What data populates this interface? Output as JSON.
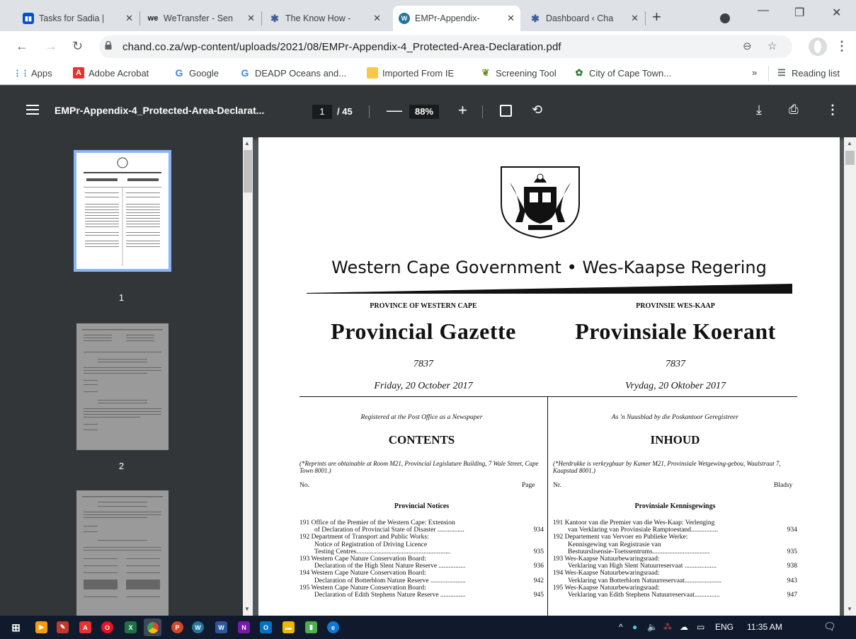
{
  "tabs": [
    {
      "title": "Tasks for Sadia |",
      "icon": "trello-icon",
      "color": "#0052cc"
    },
    {
      "title": "WeTransfer - Sen",
      "icon": "wetransfer-icon",
      "color": "#17181a"
    },
    {
      "title": "The Know How -",
      "icon": "gear-icon",
      "color": "#3d5a99"
    },
    {
      "title": "EMPr-Appendix-",
      "icon": "wordpress-icon",
      "color": "#21759b"
    },
    {
      "title": "Dashboard ‹ Cha",
      "icon": "gear-icon",
      "color": "#3d5a99"
    }
  ],
  "browser": {
    "url": "chand.co.za/wp-content/uploads/2021/08/EMPr-Appendix-4_Protected-Area-Declaration.pdf",
    "new_tab": "+"
  },
  "bookmarks": [
    {
      "label": "Apps",
      "icon": "apps-grid-icon",
      "color": "#1a73e8"
    },
    {
      "label": "Adobe Acrobat",
      "icon": "acrobat-icon",
      "color": "#e8312f"
    },
    {
      "label": "Google",
      "icon": "google-icon",
      "color": "#4285f4"
    },
    {
      "label": "DEADP Oceans and...",
      "icon": "google-icon",
      "color": "#4285f4"
    },
    {
      "label": "Imported From IE",
      "icon": "folder-icon",
      "color": "#f9c846"
    },
    {
      "label": "Screening Tool",
      "icon": "leaf-icon",
      "color": "#6b8e23"
    },
    {
      "label": "City of Cape Town...",
      "icon": "city-icon",
      "color": "#2e7d32"
    }
  ],
  "bookmarks_overflow": "»",
  "reading_list": "Reading list",
  "pdf": {
    "title": "EMPr-Appendix-4_Protected-Area-Declarat...",
    "page_current": "1",
    "page_total": "/ 45",
    "zoom": "88%",
    "zoom_minus": "—",
    "zoom_plus": "+"
  },
  "thumbnails": [
    {
      "number": "1",
      "selected": true
    },
    {
      "number": "2",
      "selected": false
    },
    {
      "number": "3",
      "selected": false
    }
  ],
  "document": {
    "government": "Western Cape Government  •  Wes-Kaapse Regering",
    "left": {
      "province": "PROVINCE OF WESTERN CAPE",
      "gazette": "Provincial Gazette",
      "number": "7837",
      "date": "Friday, 20 October 2017",
      "registered": "Registered at the Post Office as a Newspaper",
      "contents": "CONTENTS",
      "reprint": "(*Reprints are obtainable at Room M21, Provincial Legislature Building, 7 Wale Street, Cape Town 8001.)",
      "col_no": "No.",
      "col_page": "Page",
      "section": "Provincial Notices",
      "entries": [
        {
          "lines": [
            "191 Office of the Premier of the Western Cape: Extension",
            "of Declaration of Provincial State of Disaster ................"
          ],
          "page": "934"
        },
        {
          "lines": [
            "192 Department of Transport and Public Works:",
            "Notice of Registration of Driving Licence",
            "Testing Centres........................................................"
          ],
          "page": "935"
        },
        {
          "lines": [
            "193 Western Cape Nature Conservation Board:",
            "Declaration of the High Slent Nature Reserve ................"
          ],
          "page": "936"
        },
        {
          "lines": [
            "194 Western Cape Nature Conservation Board:",
            "Declaration of Botterblom Nature Reserve ....................."
          ],
          "page": "942"
        },
        {
          "lines": [
            "195 Western Cape Nature Conservation Board:",
            "Declaration of Edith Stephens Nature Reserve ..............."
          ],
          "page": "945"
        }
      ]
    },
    "right": {
      "province": "PROVINSIE WES-KAAP",
      "gazette": "Provinsiale Koerant",
      "number": "7837",
      "date": "Vrydag, 20 Oktober 2017",
      "registered": "As 'n Nuusblad by die Poskantoor Geregistreer",
      "contents": "INHOUD",
      "reprint": "(*Herdrukke is verkrygbaar by Kamer M21, Provinsiale Wetgewing-gebou, Waalstraat 7, Kaapstad 8001.)",
      "col_no": "Nr.",
      "col_page": "Bladsy",
      "section": "Provinsiale Kennisgewings",
      "entries": [
        {
          "lines": [
            "191 Kantoor van die Premier van die Wes-Kaap: Verlenging",
            "van Verklaring van Provinsiale Ramptoestand................"
          ],
          "page": "934"
        },
        {
          "lines": [
            "192 Departement van Vervoer en Publieke Werke:",
            "Kennisgewing van Registrasie van",
            "Bestuurslisensie-Toetssentrums.................................."
          ],
          "page": "935"
        },
        {
          "lines": [
            "193 Wes-Kaapse Natuurbewaringsraad:",
            "Verklaring van High Slent Natuurreservaat ..................."
          ],
          "page": "938"
        },
        {
          "lines": [
            "194 Wes-Kaapse Natuurbewaringsraad:",
            "Verklaring van Botterblom Natuurreservaat......................"
          ],
          "page": "943"
        },
        {
          "lines": [
            "195 Wes-Kaapse Natuurbewaringsraad:",
            "Verklaring van Edith Stephens Natuurreservaat..............."
          ],
          "page": "947"
        }
      ]
    }
  },
  "taskbar": {
    "language": "ENG",
    "time": "11:35 AM",
    "apps": [
      "windows-start-icon",
      "media-player-icon",
      "paint-icon",
      "acrobat-icon",
      "opera-icon",
      "excel-icon",
      "chrome-icon",
      "powerpoint-icon",
      "wordpress-icon",
      "word-icon",
      "onenote-icon",
      "outlook-icon",
      "file-explorer-icon",
      "notes-icon",
      "edge-icon"
    ]
  }
}
